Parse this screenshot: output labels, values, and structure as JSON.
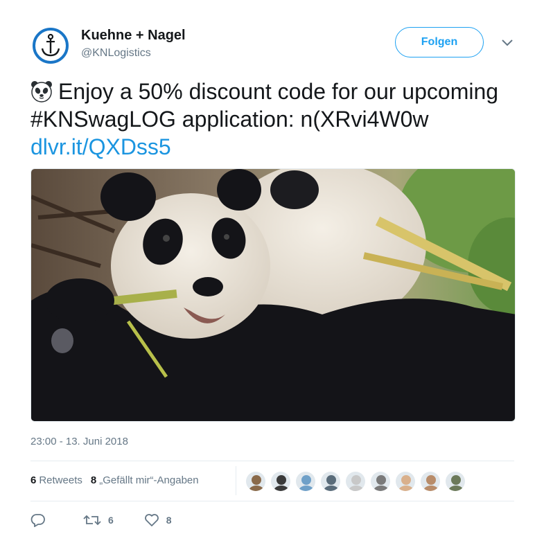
{
  "account": {
    "name": "Kuehne + Nagel",
    "handle": "@KNLogistics",
    "brand_color": "#1a76c7"
  },
  "header": {
    "follow_label": "Folgen",
    "more_icon": "chevron-down-icon"
  },
  "tweet": {
    "emoji": "panda-face",
    "text_main": "Enjoy a 50% discount code for our upcoming #KNSwagLOG application: n(XRvi4W0w",
    "link": "dlvr.it/QXDss5",
    "image_subject": "panda-photo",
    "timestamp": "23:00 - 13. Juni 2018"
  },
  "stats": {
    "retweets_count": "6",
    "retweets_label": "Retweets",
    "likes_count": "8",
    "likes_label": "„Gefällt mir“-Angaben",
    "liker_faces": [
      "#8a6a4a",
      "#3a3a3a",
      "#6fa0c8",
      "#5a6c7a",
      "#c8c8c8",
      "#7a7a7a",
      "#d9b08c",
      "#b88c6a",
      "#6c7a5a"
    ]
  },
  "actions": {
    "reply_icon": "reply-icon",
    "retweet_icon": "retweet-icon",
    "retweet_count": "6",
    "like_icon": "heart-icon",
    "like_count": "8"
  }
}
